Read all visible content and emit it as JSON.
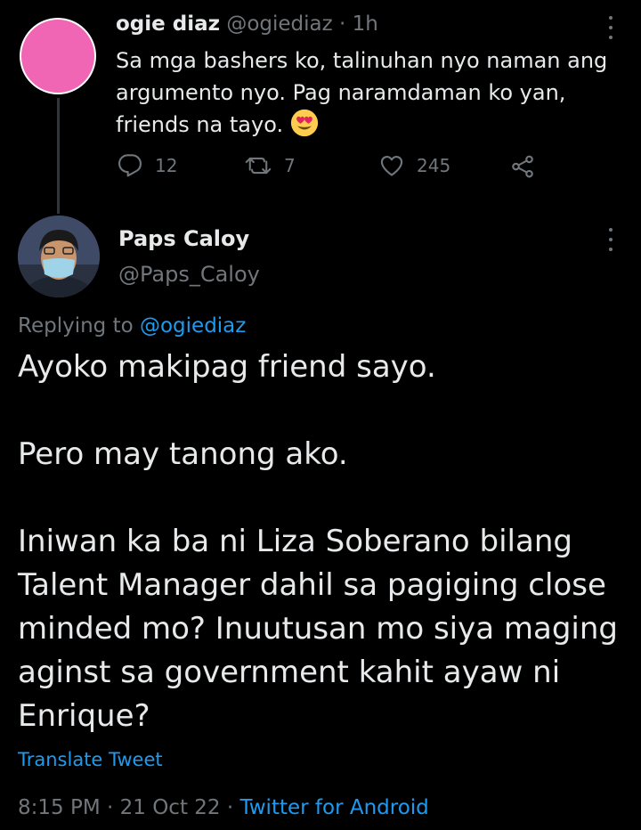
{
  "parent_tweet": {
    "display_name": "ogie diaz",
    "handle": "@ogiediaz",
    "separator": " · ",
    "time_ago": "1h",
    "avatar_color": "#f066b4",
    "text": "Sa mga bashers ko, talinuhan nyo naman ang argumento nyo. Pag naramdaman ko yan, friends na tayo.",
    "emoji": "smiling-face-with-heart-eyes",
    "actions": {
      "replies": "12",
      "retweets": "7",
      "likes": "245"
    }
  },
  "reply_tweet": {
    "display_name": "Paps Caloy",
    "handle": "@Paps_Caloy",
    "replying_prefix": "Replying to",
    "replying_to": "@ogiediaz",
    "paragraphs": [
      "Ayoko makipag friend sayo.",
      "Pero may tanong ako.",
      "Iniwan ka ba ni Liza Soberano bilang Talent Manager dahil sa pagiging close minded mo? Inuutusan mo siya maging aginst sa government kahit ayaw ni Enrique?"
    ],
    "translate_label": "Translate Tweet",
    "time": "8:15 PM",
    "date": "21 Oct 22",
    "source": "Twitter for Android"
  },
  "colors": {
    "background": "#000000",
    "text": "#e7e9ea",
    "muted": "#71767b",
    "accent": "#1d9bf0",
    "thread_line": "#333639"
  },
  "icons": {
    "reply": "comment-icon",
    "retweet": "retweet-icon",
    "like": "heart-icon",
    "share": "share-icon",
    "menu": "more-dots-icon"
  }
}
